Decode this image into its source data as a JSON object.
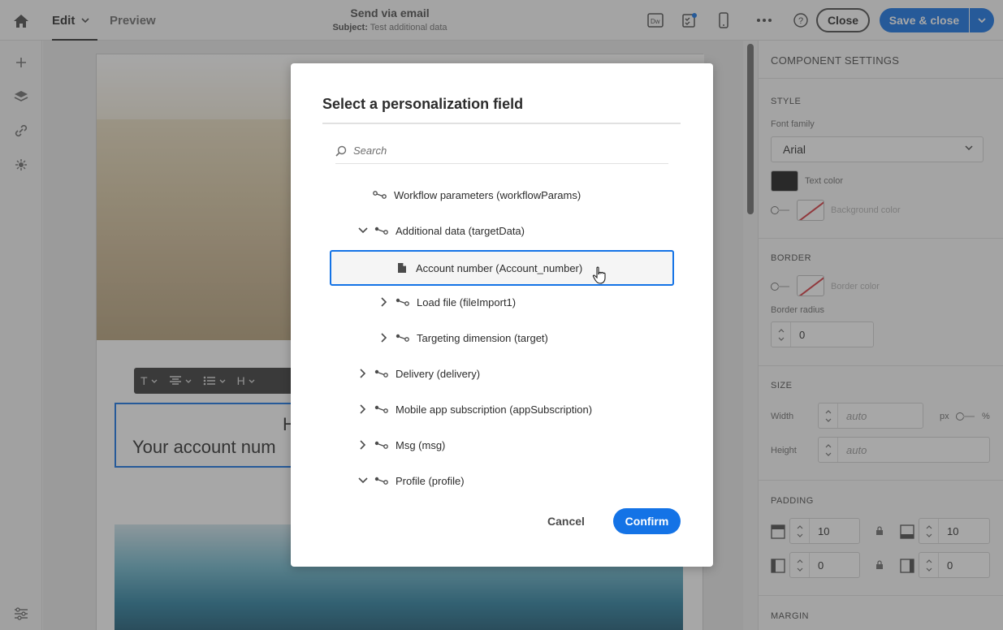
{
  "topbar": {
    "tabs": [
      {
        "label": "Edit",
        "active": true
      },
      {
        "label": "Preview",
        "active": false
      }
    ],
    "title": "Send via email",
    "subject_label": "Subject:",
    "subject_value": "Test additional data",
    "close_label": "Close",
    "save_close_label": "Save & close",
    "icons": [
      "dreamweaver-icon",
      "checklist-icon",
      "mobile-preview-icon",
      "more-icon",
      "help-icon"
    ]
  },
  "leftrail": {
    "icons": [
      "add-icon",
      "layers-icon",
      "link-icon",
      "asset-icon",
      "settings-icon"
    ]
  },
  "canvas": {
    "text_block_line1": "H",
    "text_block_line2": "Your account num",
    "toolbar_items": [
      "T",
      "H"
    ]
  },
  "rightpanel": {
    "title": "COMPONENT SETTINGS",
    "style": {
      "section": "STYLE",
      "font_family_label": "Font family",
      "font_family_value": "Arial",
      "text_color_label": "Text color",
      "text_color_value": "#1b1b1b",
      "background_color_label": "Background color"
    },
    "border": {
      "section": "BORDER",
      "border_color_label": "Border color",
      "border_radius_label": "Border radius",
      "border_radius_value": "0"
    },
    "size": {
      "section": "SIZE",
      "width_label": "Width",
      "width_placeholder": "auto",
      "unit_px": "px",
      "unit_pct": "%",
      "height_label": "Height",
      "height_placeholder": "auto"
    },
    "padding": {
      "section": "PADDING",
      "top": "10",
      "bottom": "10",
      "left": "0",
      "right": "0"
    },
    "margin": {
      "section": "MARGIN"
    }
  },
  "modal": {
    "title": "Select a personalization field",
    "search_placeholder": "Search",
    "tree": [
      {
        "label": "Workflow parameters (workflowParams)",
        "level": 0,
        "state": "none",
        "type": "link"
      },
      {
        "label": "Additional data (targetData)",
        "level": 0,
        "state": "expanded",
        "type": "link"
      },
      {
        "label": "Account number (Account_number)",
        "level": 1,
        "state": "none",
        "type": "field",
        "selected": true
      },
      {
        "label": "Load file (fileImport1)",
        "level": 1,
        "state": "collapsed",
        "type": "link"
      },
      {
        "label": "Targeting dimension (target)",
        "level": 1,
        "state": "collapsed",
        "type": "link"
      },
      {
        "label": "Delivery (delivery)",
        "level": 0,
        "state": "collapsed",
        "type": "link"
      },
      {
        "label": "Mobile app subscription (appSubscription)",
        "level": 0,
        "state": "collapsed",
        "type": "link"
      },
      {
        "label": "Msg (msg)",
        "level": 0,
        "state": "collapsed",
        "type": "link"
      },
      {
        "label": "Profile (profile)",
        "level": 0,
        "state": "expanded",
        "type": "link"
      }
    ],
    "cancel_label": "Cancel",
    "confirm_label": "Confirm"
  },
  "colors": {
    "accent": "#1473e6",
    "text": "#2c2c2c",
    "muted": "#6e6e6e",
    "no_color_slash": "#d7373f"
  }
}
